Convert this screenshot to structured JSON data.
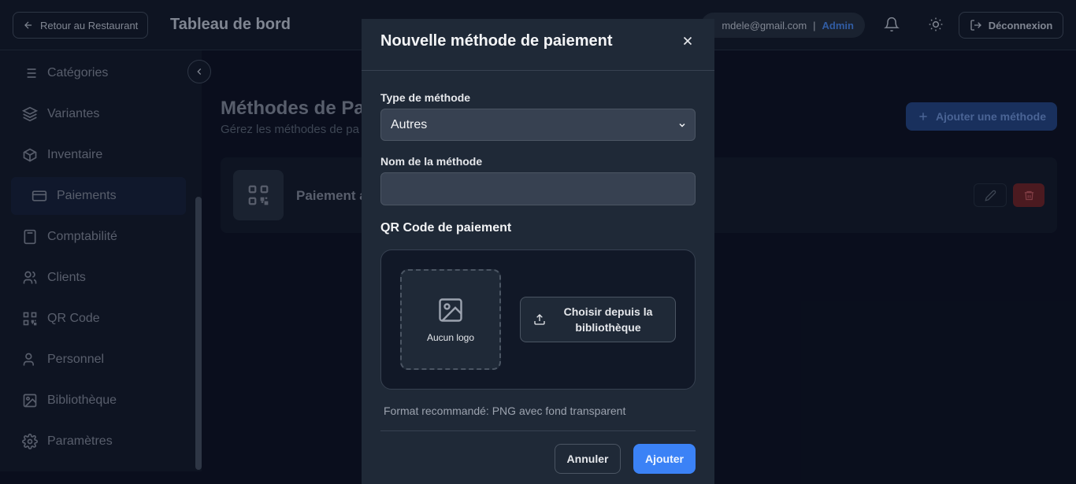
{
  "header": {
    "back_label": "Retour au Restaurant",
    "title": "Tableau de bord",
    "user_email": "mdele@gmail.com",
    "separator": "|",
    "user_role": "Admin",
    "logout_label": "Déconnexion"
  },
  "sidebar": {
    "items": [
      {
        "label": "Catégories",
        "icon": "list-icon"
      },
      {
        "label": "Variantes",
        "icon": "layers-icon"
      },
      {
        "label": "Inventaire",
        "icon": "box-icon"
      },
      {
        "label": "Paiements",
        "icon": "credit-card-icon",
        "active": true
      },
      {
        "label": "Comptabilité",
        "icon": "calculator-icon"
      },
      {
        "label": "Clients",
        "icon": "users-icon"
      },
      {
        "label": "QR Code",
        "icon": "qr-code-icon"
      },
      {
        "label": "Personnel",
        "icon": "user-icon"
      },
      {
        "label": "Bibliothèque",
        "icon": "image-icon"
      },
      {
        "label": "Paramètres",
        "icon": "gear-icon"
      }
    ]
  },
  "main": {
    "title": "Méthodes de Pa",
    "subtitle": "Gérez les méthodes de pa",
    "add_button": "Ajouter une méthode",
    "methods": [
      {
        "name": "Paiement a"
      }
    ]
  },
  "modal": {
    "title": "Nouvelle méthode de paiement",
    "type_label": "Type de méthode",
    "type_value": "Autres",
    "name_label": "Nom de la méthode",
    "name_value": "",
    "qr_section_label": "QR Code de paiement",
    "logo_placeholder": "Aucun logo",
    "library_button": "Choisir depuis la bibliothèque",
    "hint": "Format recommandé: PNG avec fond transparent",
    "cancel_label": "Annuler",
    "submit_label": "Ajouter"
  },
  "colors": {
    "accent": "#3b82f6",
    "danger": "#5b1f24",
    "role": "#3b6fc4"
  }
}
